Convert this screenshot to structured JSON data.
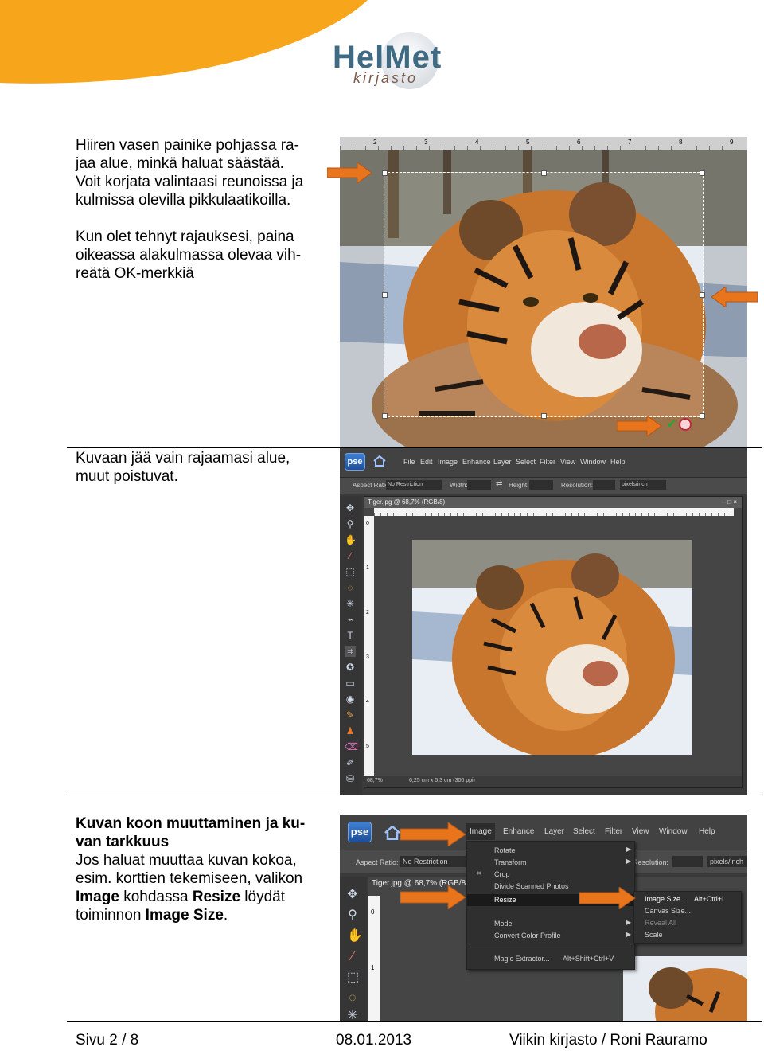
{
  "header": {
    "logo_main": "HelMet",
    "logo_sub": "kirjasto",
    "colors": {
      "orange": "#f7a51b",
      "logo_blue": "#3e6a84",
      "logo_brown": "#7a5a4a"
    }
  },
  "sections": {
    "crop": {
      "para1": [
        "Hiiren vasen painike pohjassa ra-",
        "jaa alue, minkä haluat säästää.",
        "Voit korjata valintaasi reunoissa ja",
        "kulmissa olevilla pikkulaatikoilla."
      ],
      "para2": [
        "Kun olet tehnyt rajauksesi, paina",
        "oikeassa alakulmassa olevaa vih-",
        "reätä OK-merkkiä"
      ]
    },
    "result": {
      "para": [
        "Kuvaan jää vain rajaamasi alue,",
        "muut poistuvat."
      ]
    },
    "resize": {
      "heading": [
        "Kuvan koon muuttaminen ja ku-",
        "van tarkkuus"
      ],
      "line1": "Jos haluat muuttaa kuvan kokoa,",
      "line2": "esim. korttien tekemiseen, valikon",
      "line3_bold1": "Image",
      "line3_rest": " kohdassa ",
      "line3_bold2": "Resize",
      "line3_end": " löydät",
      "line4_pre": "toiminnon ",
      "line4_bold": "Image Size",
      "line4_end": "."
    }
  },
  "screenshot1": {
    "ruler_numbers": [
      "2",
      "3",
      "4",
      "5",
      "6",
      "7",
      "8",
      "9"
    ]
  },
  "screenshot2": {
    "logo": "pse",
    "menu": [
      "File",
      "Edit",
      "Image",
      "Enhance",
      "Layer",
      "Select",
      "Filter",
      "View",
      "Window",
      "Help"
    ],
    "options": {
      "aspect_label": "Aspect Ratio:",
      "aspect_value": "No Restriction",
      "width_label": "Width:",
      "height_label": "Height:",
      "resolution_label": "Resolution:",
      "unit_value": "pixels/inch"
    },
    "doc_title": "Tiger.jpg @ 68,7% (RGB/8)",
    "window_buttons": "– □ ×",
    "status_zoom": "68,7%",
    "status_size": "6,25 cm x 5,3 cm (300 ppi)",
    "vruler": [
      "0",
      "1",
      "2",
      "3",
      "4",
      "5"
    ]
  },
  "screenshot3": {
    "logo": "pse",
    "menu": [
      "Image",
      "Enhance",
      "Layer",
      "Select",
      "Filter",
      "View",
      "Window",
      "Help"
    ],
    "aspect_label": "Aspect Ratio:",
    "aspect_value": "No Restriction",
    "resolution_label": "Resolution:",
    "unit_value": "pixels/inch",
    "doc_title": "Tiger.jpg @ 68,7% (RGB/8",
    "image_menu": [
      "Rotate",
      "Transform",
      "Crop",
      "Divide Scanned Photos",
      "Resize",
      "Mode",
      "Convert Color Profile"
    ],
    "magic_extractor": "Magic Extractor...",
    "magic_shortcut": "Alt+Shift+Ctrl+V",
    "resize_menu": [
      {
        "label": "Image Size...",
        "shortcut": "Alt+Ctrl+I"
      },
      {
        "label": "Canvas Size...",
        "shortcut": ""
      },
      {
        "label": "Reveal All",
        "shortcut": ""
      },
      {
        "label": "Scale",
        "shortcut": ""
      }
    ],
    "vruler": [
      "0",
      "1"
    ]
  },
  "footer": {
    "page": "Sivu 2 / 8",
    "date": "08.01.2013",
    "author": "Viikin kirjasto / Roni Rauramo"
  }
}
